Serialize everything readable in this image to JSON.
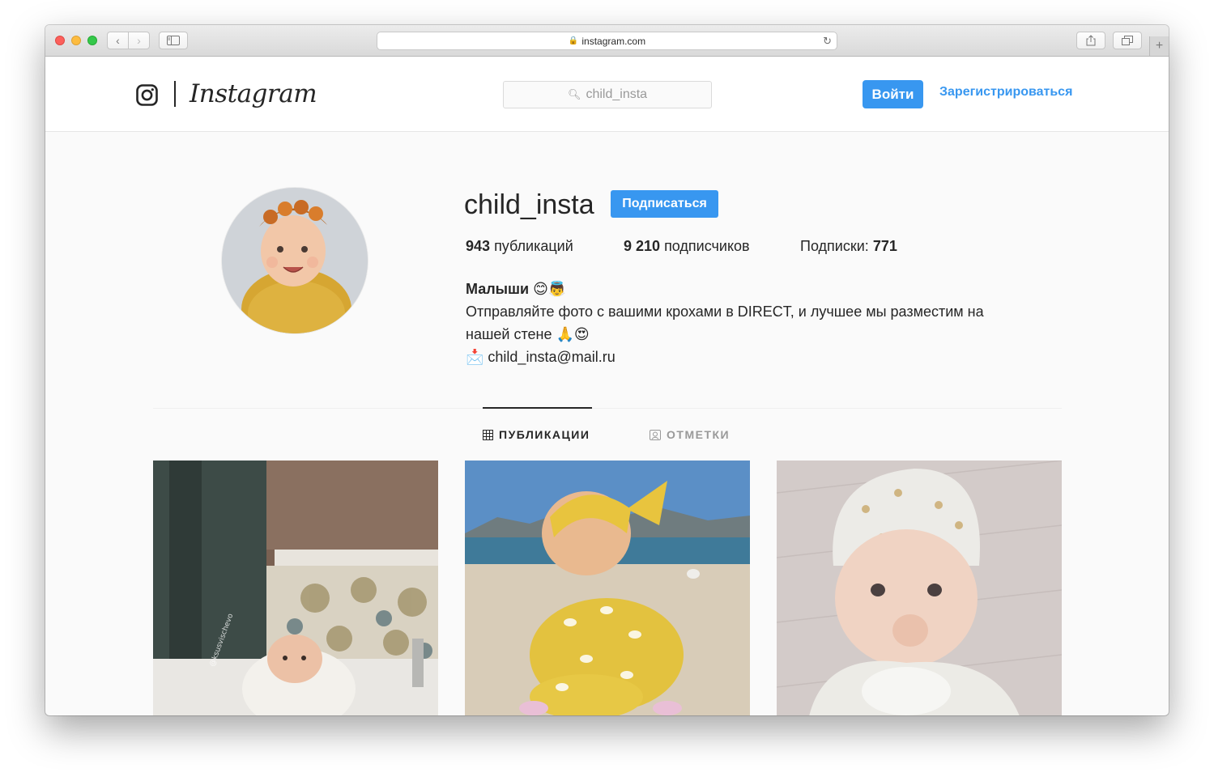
{
  "browser": {
    "url": "instagram.com"
  },
  "header": {
    "wordmark": "Instagram",
    "search_value": "child_insta",
    "login_label": "Войти",
    "signup_label": "Зарегистрироваться"
  },
  "profile": {
    "username": "child_insta",
    "follow_label": "Подписаться",
    "stats": {
      "posts_count": "943",
      "posts_label": "публикаций",
      "followers_count": "9 210",
      "followers_label": "подписчиков",
      "following_label": "Подписки:",
      "following_count": "771"
    },
    "bio": {
      "name": "Малыши 😊👼",
      "line1": "Отправляйте фото с вашими крохами в DIRECT, и лучшее мы разместим на",
      "line2": "нашей стене 🙏😍",
      "email": "📩 child_insta@mail.ru"
    }
  },
  "tabs": {
    "posts": "ПУБЛИКАЦИИ",
    "tagged": "ОТМЕТКИ",
    "active": "posts"
  },
  "posts": [
    {
      "watermark": "@ksusvischevo"
    },
    {},
    {}
  ],
  "colors": {
    "accent": "#3897f0",
    "text": "#262626",
    "muted": "#999999"
  }
}
